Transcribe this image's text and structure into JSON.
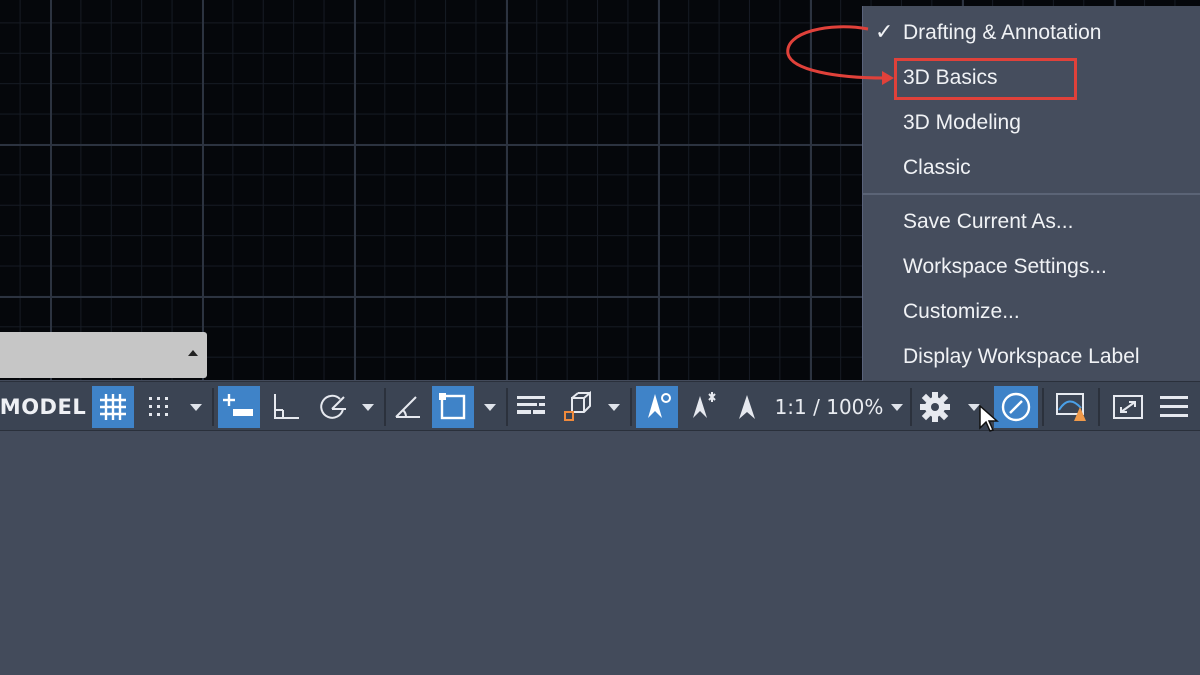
{
  "statusbar": {
    "model_label": "MODEL",
    "scale_label": "1:1 / 100%",
    "icons": [
      "grid-icon",
      "snap-icon",
      "infer-constraints-icon",
      "ortho-icon",
      "polar-icon",
      "isodraft-icon",
      "object-snap-icon",
      "lineweight-icon",
      "selection-cycling-icon",
      "annotation-visibility-icon",
      "auto-scale-icon",
      "annotation-scale-icon",
      "workspace-gear-icon",
      "units-icon",
      "isolate-objects-icon",
      "fullscreen-icon",
      "customization-icon"
    ]
  },
  "workspace_menu": {
    "items": [
      {
        "label": "Drafting & Annotation",
        "checked": true
      },
      {
        "label": "3D Basics",
        "checked": false
      },
      {
        "label": "3D Modeling",
        "checked": false
      },
      {
        "label": "Classic",
        "checked": false
      },
      {
        "label": "Save Current As...",
        "checked": false
      },
      {
        "label": "Workspace Settings...",
        "checked": false
      },
      {
        "label": "Customize...",
        "checked": false
      },
      {
        "label": "Display Workspace Label",
        "checked": false
      }
    ],
    "checkmark": "✓",
    "highlighted_item": "3D Basics"
  },
  "colors": {
    "canvas": "#05070b",
    "statusbar": "#3b4453",
    "active_button": "#3f83c8",
    "annotation": "#e0413a",
    "menu": "#454d5d"
  }
}
